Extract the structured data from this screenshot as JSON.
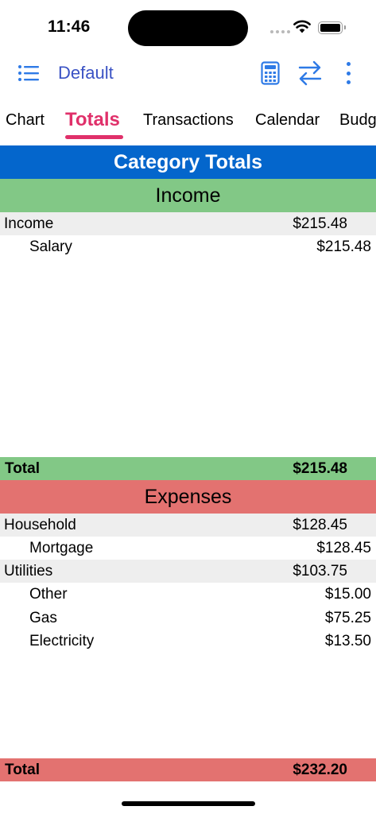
{
  "status_bar": {
    "time": "11:46"
  },
  "nav": {
    "title": "Default"
  },
  "tabs": [
    "Chart",
    "Totals",
    "Transactions",
    "Calendar",
    "Budg"
  ],
  "report": {
    "title": "Category Totals",
    "income": {
      "header": "Income",
      "rows": [
        {
          "label": "Income",
          "amount": "$215.48"
        },
        {
          "label": "Salary",
          "amount": "$215.48"
        }
      ],
      "total_label": "Total",
      "total_amount": "$215.48"
    },
    "expenses": {
      "header": "Expenses",
      "rows": [
        {
          "label": "Household",
          "amount": "$128.45"
        },
        {
          "label": "Mortgage",
          "amount": "$128.45"
        },
        {
          "label": "Utilities",
          "amount": "$103.75"
        },
        {
          "label": "Other",
          "amount": "$15.00"
        },
        {
          "label": "Gas",
          "amount": "$75.25"
        },
        {
          "label": "Electricity",
          "amount": "$13.50"
        }
      ],
      "total_label": "Total",
      "total_amount": "$232.20"
    }
  },
  "colors": {
    "accent": "#2e7ae6",
    "active_tab": "#e0306a",
    "header_blue": "#0466cc",
    "income_green": "#82c886",
    "expense_red": "#e37270"
  },
  "icons": [
    "list-icon",
    "calculator-icon",
    "swap-arrows-icon",
    "more-vertical-icon",
    "wifi-icon",
    "battery-icon"
  ]
}
